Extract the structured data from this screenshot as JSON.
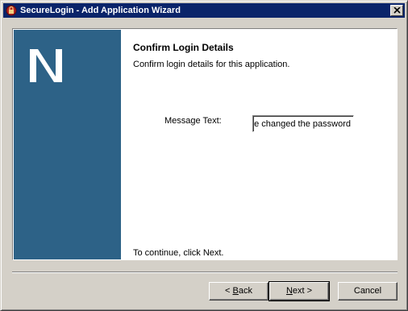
{
  "window": {
    "title": "SecureLogin - Add Application Wizard",
    "close_icon": "close-x-icon",
    "app_icon": "securelogin-app-icon"
  },
  "sidebar": {
    "logo_letter": "N",
    "color": "#2d6287"
  },
  "content": {
    "heading": "Confirm Login Details",
    "subheading": "Confirm login details for this application.",
    "message_label": "Message Text:",
    "message_value": "e changed the password",
    "footer": "To continue, click Next."
  },
  "buttons": {
    "back": {
      "prefix": "< ",
      "mnemonic": "B",
      "rest": "ack"
    },
    "next": {
      "mnemonic": "N",
      "rest": "ext >"
    },
    "cancel": "Cancel"
  },
  "colors": {
    "titlebar": "#0a246a",
    "dialog": "#d4d0c8",
    "accent_icon": "#b22222"
  }
}
